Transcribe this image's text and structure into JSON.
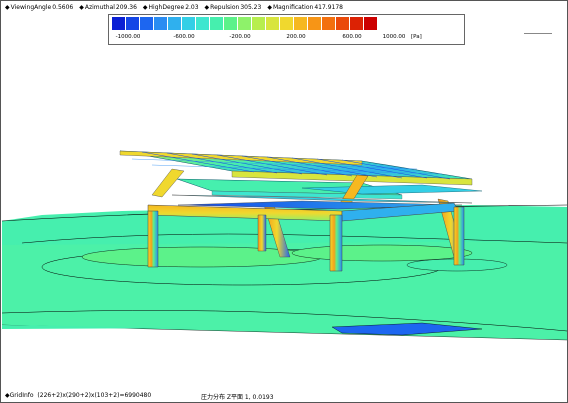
{
  "view_params": [
    {
      "label": "ViewingAngle",
      "value": "0.5606"
    },
    {
      "label": "Azimuthal",
      "value": "209.36"
    },
    {
      "label": "HighDegree",
      "value": "2.03"
    },
    {
      "label": "Repulsion",
      "value": "305.23"
    },
    {
      "label": "Magnification",
      "value": "417.9178"
    }
  ],
  "legend": {
    "colors": [
      "#0a1fd4",
      "#1546e6",
      "#1d66f0",
      "#2a8cf2",
      "#2fb0ee",
      "#33cfe6",
      "#3ee6cf",
      "#46efae",
      "#5cf28a",
      "#8ef26a",
      "#b7ee4e",
      "#d8e53e",
      "#f0d82e",
      "#f6b820",
      "#f79516",
      "#f3700e",
      "#ea4a0a",
      "#dc2204",
      "#cc0000"
    ],
    "tick_labels": [
      "-1000.00",
      "-600.00",
      "-200.00",
      "200.00",
      "600.00",
      "1000.00"
    ],
    "unit": "[Pa]"
  },
  "footer": {
    "grid_label": "GridInfo",
    "grid_value": "(226+2)x(290+2)x(103+2)=6990480",
    "result_label": "圧力分布 Z平面 1, 0.0193"
  }
}
